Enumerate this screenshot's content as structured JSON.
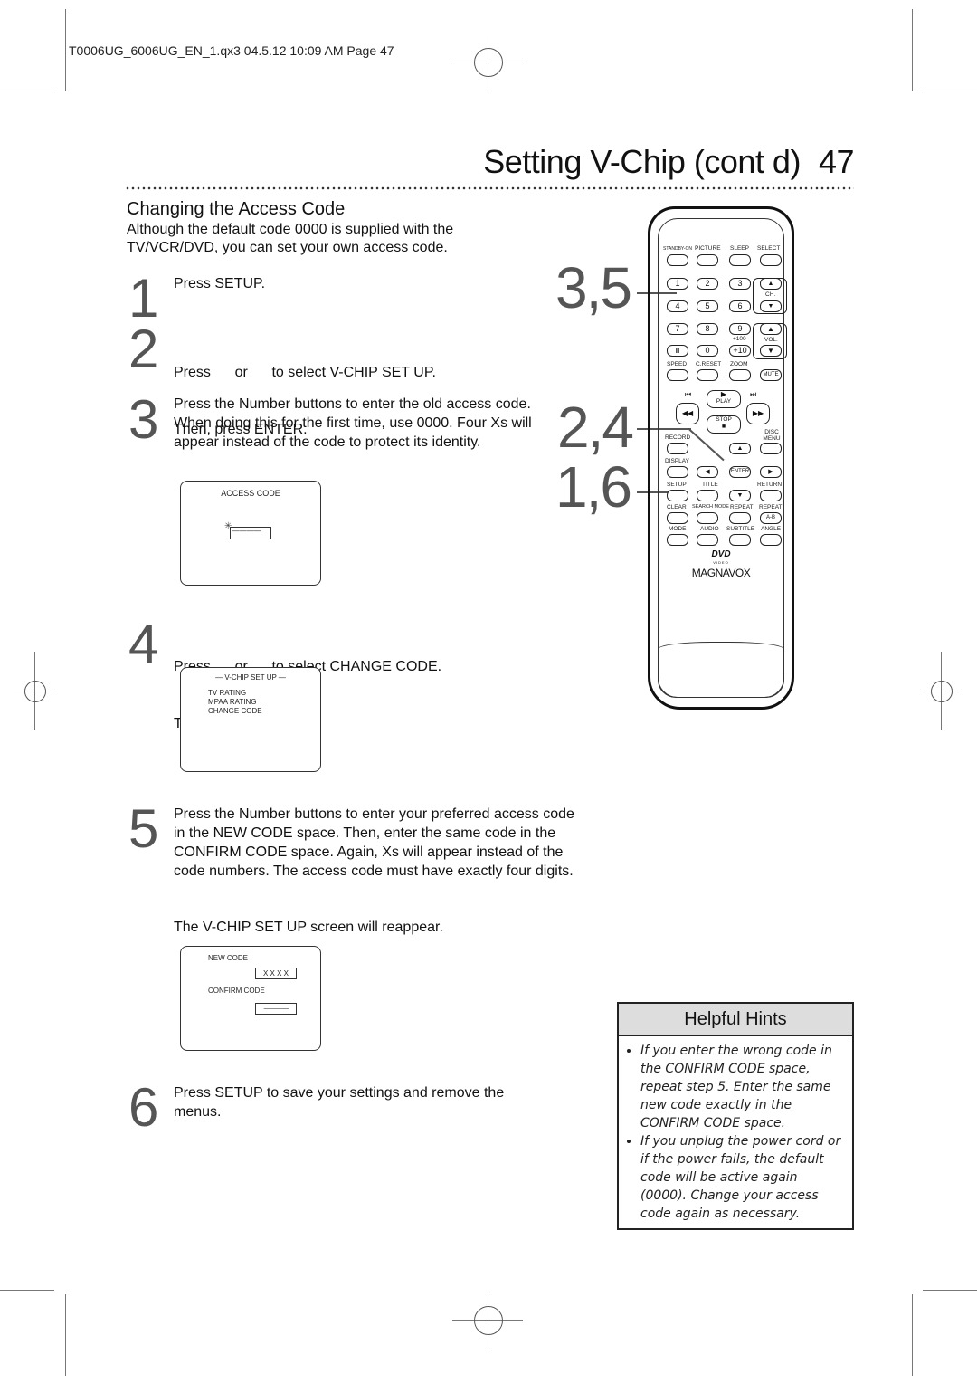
{
  "slug": "T0006UG_6006UG_EN_1.qx3  04.5.12  10:09 AM  Page 47",
  "header": {
    "title": "Setting V-Chip (cont d)",
    "page_number": "47"
  },
  "section": {
    "heading": "Changing the Access Code",
    "intro": "Although the default code 0000 is supplied with the TV/VCR/DVD, you can set your own access code."
  },
  "steps": [
    {
      "num": "1",
      "text": "Press SETUP."
    },
    {
      "num": "2",
      "line1": "Press      or      to select V-CHIP SET UP.",
      "line2": "Then, press ENTER."
    },
    {
      "num": "3",
      "text": "Press the Number buttons to enter the old access code. When doing this for the first time, use 0000. Four Xs will appear instead of the code to protect its identity."
    },
    {
      "num": "4",
      "line1": "Press      or      to select CHANGE CODE.",
      "line2": "Then, press ENTER."
    },
    {
      "num": "5",
      "text": "Press the Number buttons to enter your preferred access code in the NEW CODE space. Then, enter the same code in the CONFIRM CODE space. Again, Xs will appear instead of the code numbers. The access code must have exactly four digits.",
      "after": "The V-CHIP SET UP screen will reappear."
    },
    {
      "num": "6",
      "text": "Press SETUP to save your settings and remove the menus."
    }
  ],
  "screens": {
    "access_code": {
      "title": "ACCESS CODE",
      "value": "— — — —"
    },
    "vchip_setup": {
      "title": "— V-CHIP SET UP —",
      "items": [
        "TV RATING",
        "MPAA RATING",
        "CHANGE CODE"
      ]
    },
    "new_code": {
      "new_label": "NEW CODE",
      "new_value": "X X X X",
      "confirm_label": "CONFIRM CODE",
      "confirm_value": "— — — —"
    }
  },
  "callouts": {
    "a": "3,5",
    "b": "2,4",
    "c": "1,6"
  },
  "remote": {
    "row1": [
      "STANDBY-ON",
      "PICTURE",
      "SLEEP",
      "SELECT"
    ],
    "digits": [
      "1",
      "2",
      "3",
      "4",
      "5",
      "6",
      "7",
      "8",
      "9",
      "II",
      "0",
      "+10"
    ],
    "plus100": "+100",
    "ch": "CH.",
    "vol": "VOL.",
    "row_speed": [
      "SPEED",
      "C.RESET",
      "ZOOM"
    ],
    "mute": "MUTE",
    "play": "PLAY",
    "stop": "STOP",
    "record": "RECORD",
    "disc_menu": "DISC MENU",
    "display": "DISPLAY",
    "enter": "ENTER",
    "row_setup": [
      "SETUP",
      "TITLE",
      "RETURN"
    ],
    "row_clear": [
      "CLEAR",
      "SEARCH MODE",
      "REPEAT",
      "REPEAT"
    ],
    "ab": "A-B",
    "row_mode": [
      "MODE",
      "AUDIO",
      "SUBTITLE",
      "ANGLE"
    ],
    "dvd_logo": "DVD",
    "dvd_sub": "VIDEO",
    "brand": "MAGNAVOX"
  },
  "hints": {
    "title": "Helpful Hints",
    "items": [
      "If you enter the wrong code in the CONFIRM CODE space, repeat step 5. Enter the same new code exactly in the CONFIRM CODE space.",
      "If you unplug the power cord or if the power fails, the default code will be active again (0000). Change your access code again as necessary."
    ]
  }
}
